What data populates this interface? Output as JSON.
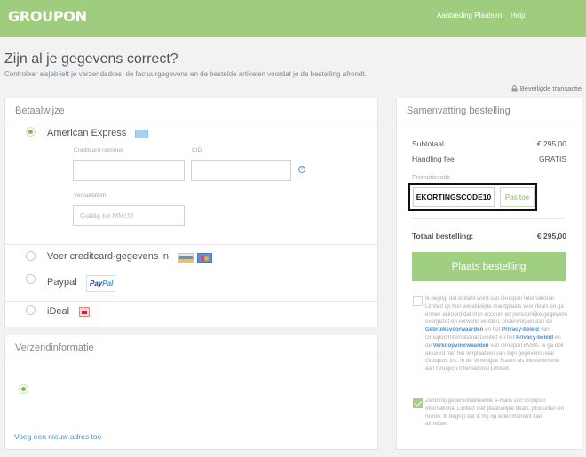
{
  "header": {
    "logo": "GROUPON",
    "nav": [
      "Aanbieding Plaatsen",
      "Help"
    ]
  },
  "page": {
    "title": "Zijn al je gegevens correct?",
    "subtitle": "Controleer alsjeblieft je verzendadres, de factuurgegevens en de bestelde artikelen voordat je de bestelling afrondt.",
    "secure_label": "Beveiligde transactie"
  },
  "payment": {
    "heading": "Betaalwijze",
    "methods": [
      {
        "label": "American Express",
        "selected": true,
        "icon": "amex-card-icon"
      },
      {
        "label": "Voer creditcard-gegevens in",
        "selected": false,
        "icon": "visa-mastercard-icons"
      },
      {
        "label": "Paypal",
        "selected": false,
        "icon": "paypal-logo"
      },
      {
        "label": "iDeal",
        "selected": false,
        "icon": "ideal-logo"
      }
    ],
    "card_number_label": "Creditcard-nummer",
    "card_number_value": "",
    "cid_label": "CID",
    "cid_value": "",
    "cid_help": "?",
    "expiry_label": "Vervaldatum",
    "expiry_placeholder": "Geldig tot MM/JJ",
    "paypal_logo_text": "Pay",
    "paypal_logo_text2": "Pal"
  },
  "shipping": {
    "heading": "Verzendinformatie",
    "add_address": "Voeg een nieuw adres toe"
  },
  "summary": {
    "heading": "Samenvatting bestelling",
    "subtotal_label": "Subtotaal",
    "subtotal_value": "€ 295,00",
    "handling_label": "Handling fee",
    "handling_value": "GRATIS",
    "promo_label": "Promotiecode",
    "promo_value": "EKORTINGSCODE10",
    "apply_label": "Pas toe",
    "total_label": "Totaal bestelling:",
    "total_value": "€ 295,00",
    "place_order": "Plaats bestelling"
  },
  "legal": {
    "terms_checked": false,
    "terms_p1": "Ik begrijp dat ik klant word van Groupon International Limited op hun wereldwijde marktplaats voor deals en ga ermee akkoord dat mijn account en persoonlijke gegevens overgezet en verwerkt worden, onderworpen aan de ",
    "terms_link1": "Gebruiksvoorwaarden",
    "terms_p2": " en het ",
    "terms_link2": "Privacy-beleid",
    "terms_p3": " van Groupon International Limited en het ",
    "terms_link3": "Privacy-beleid",
    "terms_p4": " en de ",
    "terms_link4": "Verkoopvoorwaarden",
    "terms_p5": " van Groupon BVBA. Ik ga ook akkoord met het verplaatsen van mijn gegevens naar Groupon, Inc. in de Verenigde Staten als dienstverlener aan Groupon International Limited.",
    "emails_checked": true,
    "emails_text": "Zend mij gepersonaliseerde e-mails van Groupon International Limited met plaatselijke deals, producten en reizen. Ik begrijp dat ik mij op ieder moment kan afmelden."
  },
  "colors": {
    "brand_green": "#9fcc7d",
    "button_green": "#a0cf82",
    "link_blue": "#4f8ec6"
  }
}
